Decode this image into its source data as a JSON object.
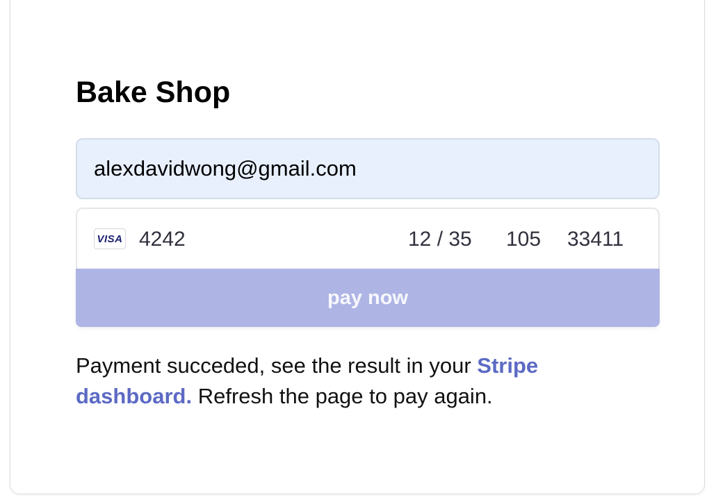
{
  "shop": {
    "title": "Bake Shop"
  },
  "form": {
    "email_value": "alexdavidwong@gmail.com",
    "card": {
      "brand": "VISA",
      "number_last4": "4242",
      "expiry": "12 / 35",
      "cvc": "105",
      "postal_code": "33411"
    },
    "pay_button_label": "pay now"
  },
  "result": {
    "text_before_link": "Payment succeded, see the result in your ",
    "link_text": "Stripe dashboard.",
    "text_after_link": " Refresh the page to pay again."
  },
  "colors": {
    "link": "#5c6ac4",
    "button_disabled": "#aeb5e4",
    "autofill_bg": "#e8f0fe",
    "card_text": "#30313d"
  }
}
